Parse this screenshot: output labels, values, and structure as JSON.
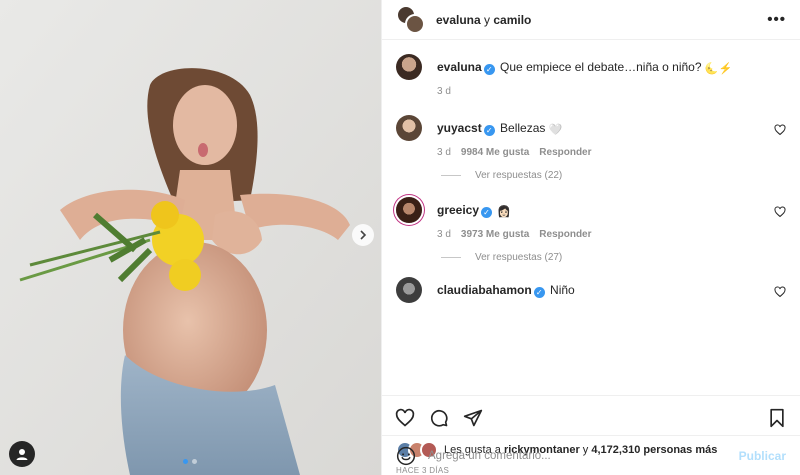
{
  "header": {
    "user1": "evaluna",
    "connector": " y ",
    "user2": "camilo",
    "more_icon": "more-horizontal-icon"
  },
  "caption": {
    "user": "evaluna",
    "text": "Que empiece el debate…niña o niño?",
    "emoji": "🌜⚡",
    "time": "3 d"
  },
  "comments": [
    {
      "user": "yuyacst",
      "text": "Bellezas",
      "emoji": "🤍",
      "time": "3 d",
      "likes": "9984 Me gusta",
      "reply": "Responder",
      "view_replies": "Ver respuestas (22)"
    },
    {
      "user": "greeicy",
      "text": "",
      "emoji": "👩🏻",
      "time": "3 d",
      "likes": "3973 Me gusta",
      "reply": "Responder",
      "view_replies": "Ver respuestas (27)"
    },
    {
      "user": "claudiabahamon",
      "text": "Niño"
    }
  ],
  "likes": {
    "prefix": "Les gusta a ",
    "user": "rickymontaner",
    "middle": " y ",
    "count": "4,172,310 personas más"
  },
  "posted_ago": "HACE 3 DÍAS",
  "add_comment": {
    "placeholder": "Agrega un comentario...",
    "publish": "Publicar"
  },
  "colors": {
    "verified": "#3897f0",
    "publish_disabled": "#b2dffc",
    "muted": "#8e8e8e"
  }
}
